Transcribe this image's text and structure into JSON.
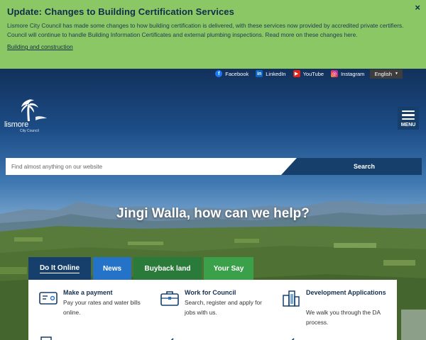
{
  "alert": {
    "title": "Update: Changes to Building Certification Services",
    "body": "Lismore City Council has made some changes to how building certification is delivered, with these services now provided by accredited private certifiers. Council will continue to handle Building Information Certificates and external plumbing inspections. Read more on these changes here.",
    "link": "Building and construction",
    "close": "×"
  },
  "social": {
    "facebook": "Facebook",
    "linkedin": "LinkedIn",
    "youtube": "YouTube",
    "instagram": "Instagram",
    "language": "English"
  },
  "logo": {
    "word": "lismore",
    "sub": "City Council"
  },
  "menu": {
    "label": "MENU"
  },
  "search": {
    "placeholder": "Find almost anything on our website",
    "button": "Search"
  },
  "hero": {
    "heading": "Jingi Walla, how can we help?"
  },
  "tabs": [
    {
      "label": "Do It Online"
    },
    {
      "label": "News"
    },
    {
      "label": "Buyback land"
    },
    {
      "label": "Your Say"
    }
  ],
  "services": [
    {
      "title": "Make a payment",
      "desc": "Pay your rates and water bills online.",
      "icon": "payment-card-icon"
    },
    {
      "title": "Work for Council",
      "desc": "Search, register and apply for jobs with us.",
      "icon": "briefcase-icon"
    },
    {
      "title": "Development Applications",
      "desc": "We walk you through the DA process.",
      "icon": "buildings-icon"
    }
  ],
  "colors": {
    "alert_bg": "#8cc765",
    "navy": "#163f6b",
    "news_blue": "#2573c8",
    "buyback_green": "#2a7a3a",
    "yoursay_green": "#3ba04a"
  }
}
